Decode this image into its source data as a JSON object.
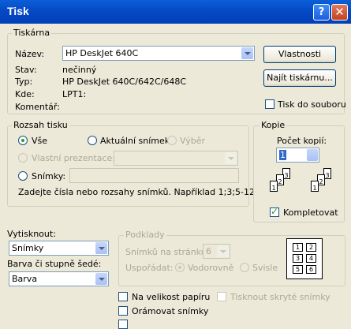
{
  "window": {
    "title": "Tisk",
    "help": "?",
    "close": "✕"
  },
  "printer": {
    "group_label": "Tiskárna",
    "name_label": "Název:",
    "name_value": "HP DeskJet 640C",
    "status_label": "Stav:",
    "status_value": "nečinný",
    "type_label": "Typ:",
    "type_value": "HP DeskJet 640C/642C/648C",
    "where_label": "Kde:",
    "where_value": "LPT1:",
    "comment_label": "Komentář:",
    "properties_button": "Vlastnosti",
    "find_printer_button": "Najít tiskárnu...",
    "print_to_file_label": "Tisk do souboru",
    "print_to_file_checked": false
  },
  "range": {
    "group_label": "Rozsah tisku",
    "all_label": "Vše",
    "current_slide_label": "Aktuální snímek",
    "selection_label": "Výběr",
    "custom_show_label": "Vlastní prezentace:",
    "slides_label": "Snímky:",
    "hint": "Zadejte čísla nebo rozsahy snímků. Například 1;3;5-12",
    "selected": "all"
  },
  "copies": {
    "group_label": "Kopie",
    "count_label": "Počet kopií:",
    "count_value": "1",
    "collate_label": "Kompletovat",
    "collate_checked": true
  },
  "print_what": {
    "label": "Vytisknout:",
    "value": "Snímky"
  },
  "color": {
    "label": "Barva či stupně šedé:",
    "value": "Barva"
  },
  "handouts": {
    "group_label": "Podklady",
    "per_page_label": "Snímků na stránku:",
    "per_page_value": "6",
    "order_label": "Uspořádat:",
    "horizontal_label": "Vodorovně",
    "vertical_label": "Svisle"
  },
  "options": {
    "scale_to_fit_label": "Na velikost papíru",
    "frame_slides_label": "Orámovat snímky",
    "print_hidden_label": "Tisknout skryté snímky"
  }
}
